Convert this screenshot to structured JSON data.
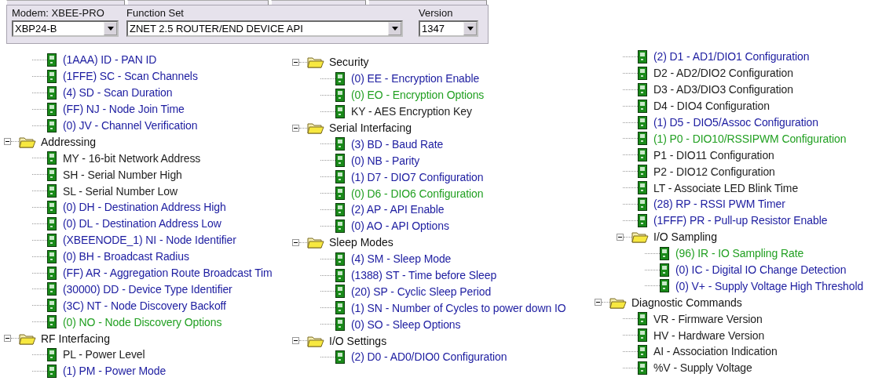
{
  "header": {
    "modem": {
      "label": "Modem: XBEE-PRO",
      "value": "XBP24-B"
    },
    "function_set": {
      "label": "Function Set",
      "value": "ZNET 2.5 ROUTER/END DEVICE API"
    },
    "version": {
      "label": "Version",
      "value": "1347"
    }
  },
  "columns": [
    {
      "nodes": [
        {
          "kind": "continued",
          "children": [
            {
              "kind": "param",
              "label": "(1AAA) ID - PAN ID",
              "color": "#1c1ca0"
            },
            {
              "kind": "param",
              "label": "(1FFE) SC - Scan Channels",
              "color": "#1c1ca0"
            },
            {
              "kind": "param",
              "label": "(4) SD - Scan Duration",
              "color": "#1c1ca0"
            },
            {
              "kind": "param",
              "label": "(FF) NJ - Node Join Time",
              "color": "#1c1ca0"
            },
            {
              "kind": "param",
              "label": "(0) JV - Channel Verification",
              "color": "#1c1ca0"
            }
          ]
        },
        {
          "kind": "folder",
          "label": "Addressing",
          "expanded": true,
          "children": [
            {
              "kind": "param",
              "label": "MY - 16-bit Network Address",
              "color": "#1e1e1e"
            },
            {
              "kind": "param",
              "label": "SH - Serial Number High",
              "color": "#1e1e1e"
            },
            {
              "kind": "param",
              "label": "SL - Serial Number Low",
              "color": "#1e1e1e"
            },
            {
              "kind": "param",
              "label": "(0) DH - Destination Address High",
              "color": "#1c1ca0"
            },
            {
              "kind": "param",
              "label": "(0) DL - Destination Address Low",
              "color": "#1c1ca0"
            },
            {
              "kind": "param",
              "label": "(XBEENODE_1) NI - Node Identifier",
              "color": "#1c1ca0"
            },
            {
              "kind": "param",
              "label": "(0) BH - Broadcast Radius",
              "color": "#1c1ca0"
            },
            {
              "kind": "param",
              "label": "(FF) AR - Aggregation Route Broadcast Tim",
              "color": "#1c1ca0"
            },
            {
              "kind": "param",
              "label": "(30000) DD - Device Type Identifier",
              "color": "#1c1ca0"
            },
            {
              "kind": "param",
              "label": "(3C) NT - Node Discovery Backoff",
              "color": "#1c1ca0"
            },
            {
              "kind": "param",
              "label": "(0) NO - Node Discovery Options",
              "color": "#22a022"
            }
          ]
        },
        {
          "kind": "folder",
          "label": "RF Interfacing",
          "expanded": true,
          "children": [
            {
              "kind": "param",
              "label": "PL - Power Level",
              "color": "#1e1e1e"
            },
            {
              "kind": "param",
              "label": "(1) PM - Power Mode",
              "color": "#1c1ca0"
            }
          ]
        }
      ]
    },
    {
      "nodes": [
        {
          "kind": "folder",
          "label": "Security",
          "expanded": true,
          "children": [
            {
              "kind": "param",
              "label": "(0) EE - Encryption Enable",
              "color": "#1c1ca0"
            },
            {
              "kind": "param",
              "label": "(0) EO - Encryption Options",
              "color": "#22a022"
            },
            {
              "kind": "param",
              "label": "KY - AES Encryption Key",
              "color": "#1e1e1e"
            }
          ]
        },
        {
          "kind": "folder",
          "label": "Serial Interfacing",
          "expanded": true,
          "children": [
            {
              "kind": "param",
              "label": "(3) BD - Baud Rate",
              "color": "#1c1ca0"
            },
            {
              "kind": "param",
              "label": "(0) NB - Parity",
              "color": "#1c1ca0"
            },
            {
              "kind": "param",
              "label": "(1) D7 - DIO7 Configuration",
              "color": "#1c1ca0"
            },
            {
              "kind": "param",
              "label": "(0) D6 - DIO6 Configuration",
              "color": "#22a022"
            },
            {
              "kind": "param",
              "label": "(2) AP - API Enable",
              "color": "#1c1ca0"
            },
            {
              "kind": "param",
              "label": "(0) AO - API Options",
              "color": "#1c1ca0"
            }
          ]
        },
        {
          "kind": "folder",
          "label": "Sleep Modes",
          "expanded": true,
          "children": [
            {
              "kind": "param",
              "label": "(4) SM - Sleep Mode",
              "color": "#1c1ca0"
            },
            {
              "kind": "param",
              "label": "(1388) ST - Time before Sleep",
              "color": "#1c1ca0"
            },
            {
              "kind": "param",
              "label": "(20) SP - Cyclic Sleep Period",
              "color": "#1c1ca0"
            },
            {
              "kind": "param",
              "label": "(1) SN - Number of Cycles to power down IO",
              "color": "#1c1ca0"
            },
            {
              "kind": "param",
              "label": "(0) SO - Sleep Options",
              "color": "#1c1ca0"
            }
          ]
        },
        {
          "kind": "folder",
          "label": "I/O Settings",
          "expanded": true,
          "children": [
            {
              "kind": "param",
              "label": "(2) D0 - AD0/DIO0 Configuration",
              "color": "#1c1ca0"
            }
          ]
        }
      ]
    },
    {
      "nodes": [
        {
          "kind": "continued",
          "children": [
            {
              "kind": "param",
              "label": "(2) D1 - AD1/DIO1 Configuration",
              "color": "#1c1ca0"
            },
            {
              "kind": "param",
              "label": "D2 - AD2/DIO2 Configuration",
              "color": "#1e1e1e"
            },
            {
              "kind": "param",
              "label": "D3 - AD3/DIO3 Configuration",
              "color": "#1e1e1e"
            },
            {
              "kind": "param",
              "label": "D4 - DIO4 Configuration",
              "color": "#1e1e1e"
            },
            {
              "kind": "param",
              "label": "(1) D5 - DIO5/Assoc Configuration",
              "color": "#1c1ca0"
            },
            {
              "kind": "param",
              "label": "(1) P0 - DIO10/RSSIPWM Configuration",
              "color": "#22a022"
            },
            {
              "kind": "param",
              "label": "P1 - DIO11 Configuration",
              "color": "#1e1e1e"
            },
            {
              "kind": "param",
              "label": "P2 - DIO12 Configuration",
              "color": "#1e1e1e"
            },
            {
              "kind": "param",
              "label": "LT - Associate LED Blink Time",
              "color": "#1e1e1e"
            },
            {
              "kind": "param",
              "label": "(28) RP - RSSI PWM Timer",
              "color": "#1c1ca0"
            },
            {
              "kind": "param",
              "label": "(1FFF) PR - Pull-up Resistor Enable",
              "color": "#1c1ca0"
            },
            {
              "kind": "folder",
              "label": "I/O Sampling",
              "expanded": true,
              "children": [
                {
                  "kind": "param",
                  "label": "(96) IR - IO Sampling Rate",
                  "color": "#22a022"
                },
                {
                  "kind": "param",
                  "label": "(0) IC - Digital IO Change Detection",
                  "color": "#1c1ca0"
                },
                {
                  "kind": "param",
                  "label": "(0) V+ - Supply Voltage High Threshold",
                  "color": "#1c1ca0"
                }
              ]
            }
          ]
        },
        {
          "kind": "folder",
          "label": "Diagnostic Commands",
          "expanded": true,
          "children": [
            {
              "kind": "param",
              "label": "VR - Firmware Version",
              "color": "#1e1e1e"
            },
            {
              "kind": "param",
              "label": "HV - Hardware Version",
              "color": "#1e1e1e"
            },
            {
              "kind": "param",
              "label": "AI - Association Indication",
              "color": "#1e1e1e"
            },
            {
              "kind": "param",
              "label": "%V - Supply Voltage",
              "color": "#1e1e1e"
            }
          ]
        }
      ]
    }
  ]
}
